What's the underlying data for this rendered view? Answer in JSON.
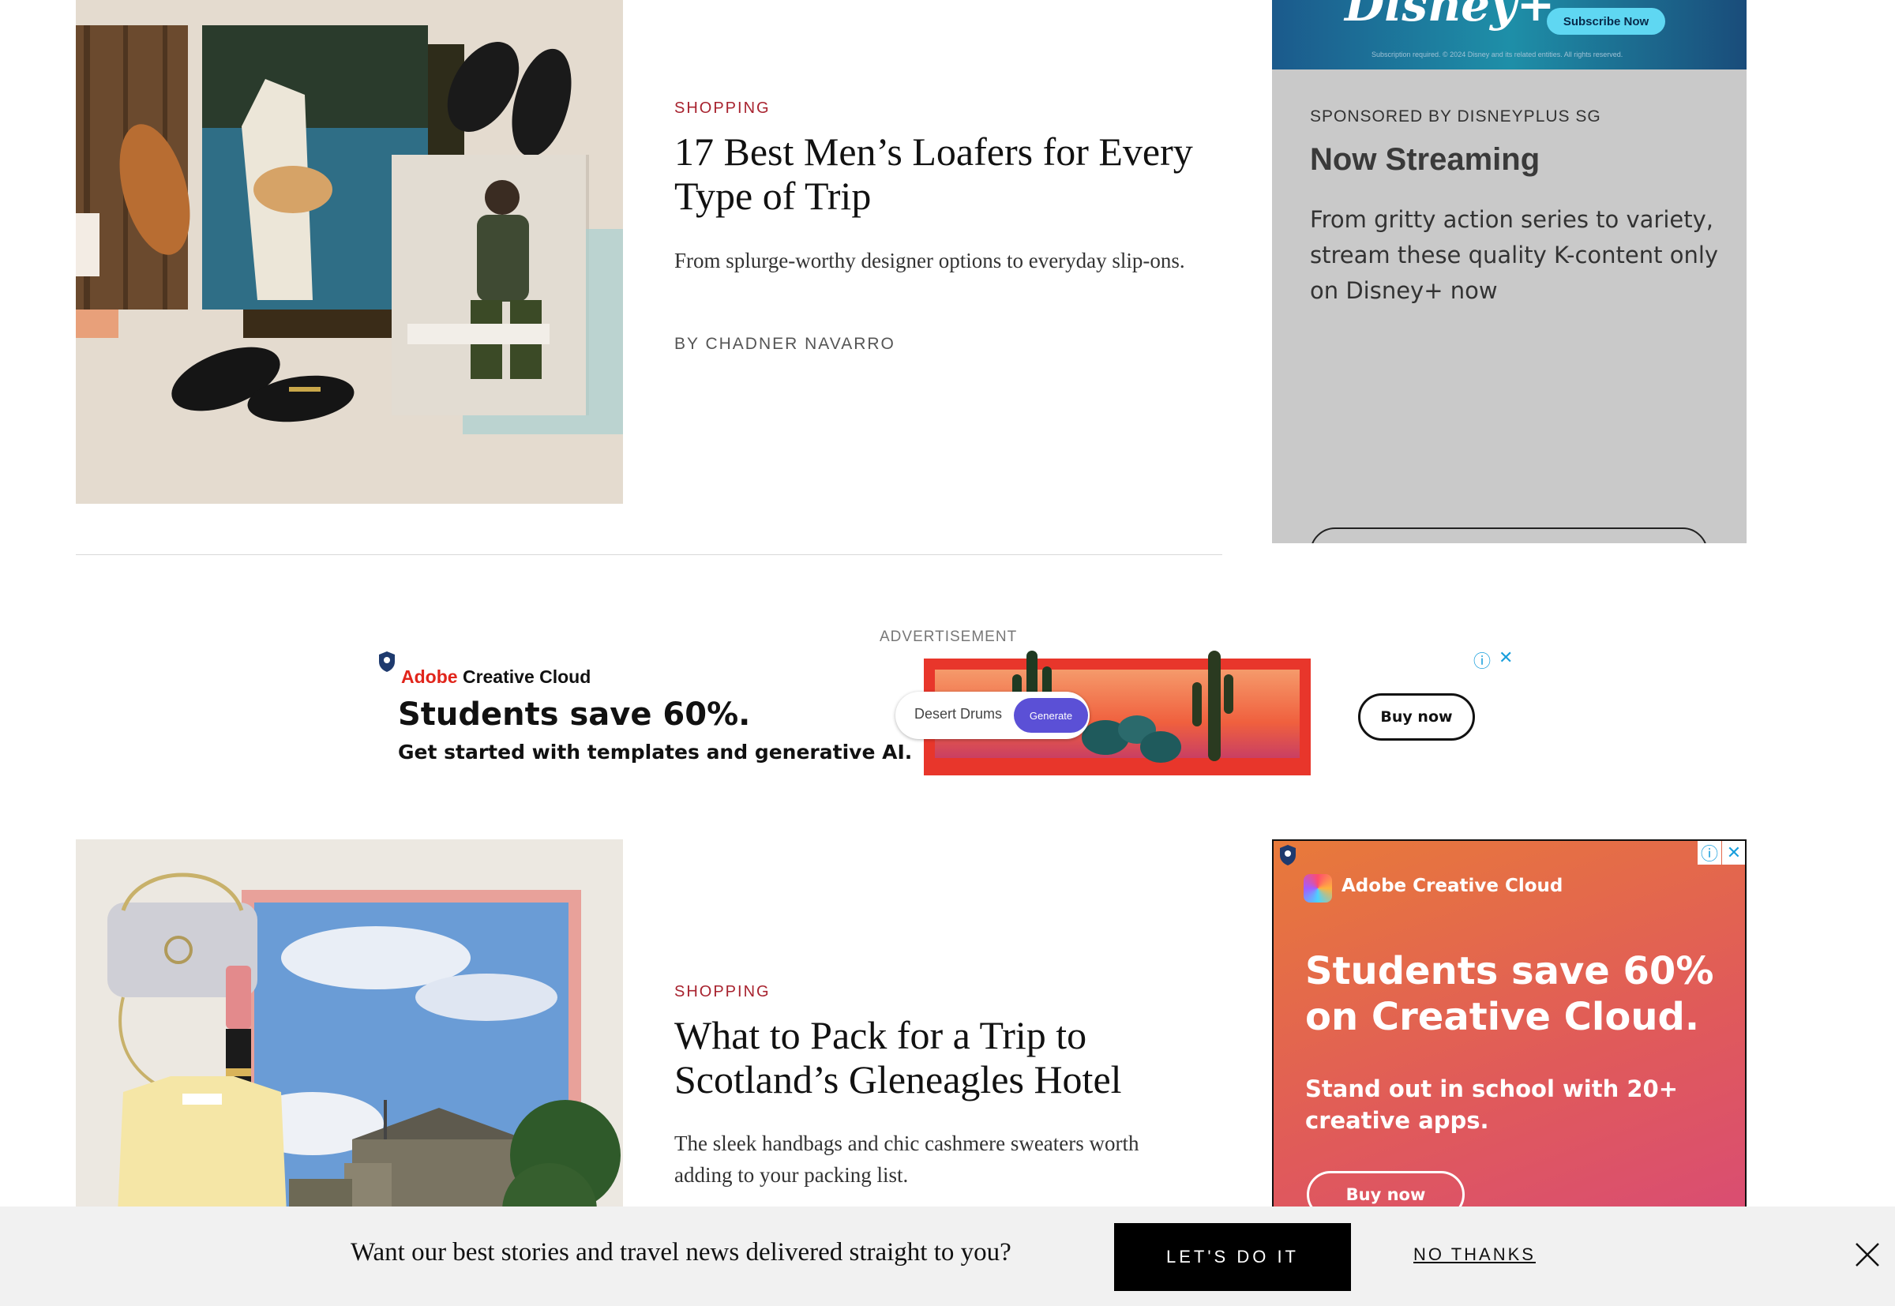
{
  "articles": [
    {
      "kicker": "SHOPPING",
      "headline": "17 Best Men’s Loafers for Every Type of Trip",
      "dek": "From splurge-worthy designer options to everyday slip-ons.",
      "byline": "BY CHADNER NAVARRO"
    },
    {
      "kicker": "SHOPPING",
      "headline": "What to Pack for a Trip to Scotland’s Gleneagles Hotel",
      "dek": "The sleek handbags and chic cashmere sweaters worth adding to your packing list."
    }
  ],
  "disney_ad": {
    "logo": "Disney+",
    "subscribe": "Subscribe Now",
    "fine_print": "Subscription required. © 2024 Disney and its related entities. All rights reserved.",
    "sponsored": "SPONSORED BY DISNEYPLUS SG",
    "headline": "Now Streaming",
    "body": "From gritty action series to variety, stream these quality K-content only on Disney+ now"
  },
  "banner_ad": {
    "label": "ADVERTISEMENT",
    "brand_red": "Adobe",
    "brand_black": "Creative Cloud",
    "headline": "Students save 60%.",
    "subline": "Get started with templates and generative AI.",
    "prompt_text": "Desert Drums",
    "generate": "Generate",
    "buy": "Buy now",
    "info": "ⓘ",
    "close": "✕"
  },
  "side_ad": {
    "brand": "Adobe Creative Cloud",
    "headline": "Students save 60% on Creative Cloud.",
    "sub": "Stand out in school with 20+ creative apps.",
    "buy": "Buy now",
    "info": "ⓘ",
    "close": "✕"
  },
  "newsletter": {
    "text": "Want our best stories and travel news delivered straight to you?",
    "accept": "LET'S DO IT",
    "decline": "NO THANKS"
  },
  "colors": {
    "kicker": "#a8232f",
    "adobe_red": "#e1251b",
    "generate_purple": "#5b50d6"
  }
}
